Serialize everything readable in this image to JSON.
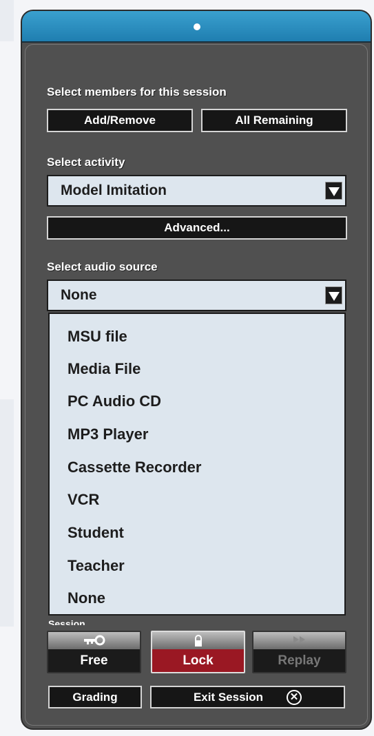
{
  "members": {
    "label": "Select members for this session",
    "add_remove": "Add/Remove",
    "all_remaining": "All Remaining"
  },
  "activity": {
    "label": "Select activity",
    "selected": "Model Imitation",
    "advanced": "Advanced..."
  },
  "audio": {
    "label": "Select audio source",
    "selected": "None",
    "options": [
      "MSU file",
      "Media File",
      "PC Audio CD",
      "MP3 Player",
      "Cassette Recorder",
      "VCR",
      "Student",
      "Teacher",
      "None"
    ]
  },
  "session": {
    "label": "Session",
    "free": "Free",
    "lock": "Lock",
    "replay": "Replay",
    "grading": "Grading",
    "exit": "Exit Session",
    "exit_icon": "⊗"
  },
  "colors": {
    "header": "#2a8fc2",
    "panel": "#505050",
    "lock": "#9a1823",
    "dropdown": "#dde6ee"
  },
  "icons": {
    "key": "key-icon",
    "lock": "lock-icon",
    "replay": "replay-icon",
    "exit": "close-circle-icon",
    "dropdown": "chevron-down-icon"
  }
}
